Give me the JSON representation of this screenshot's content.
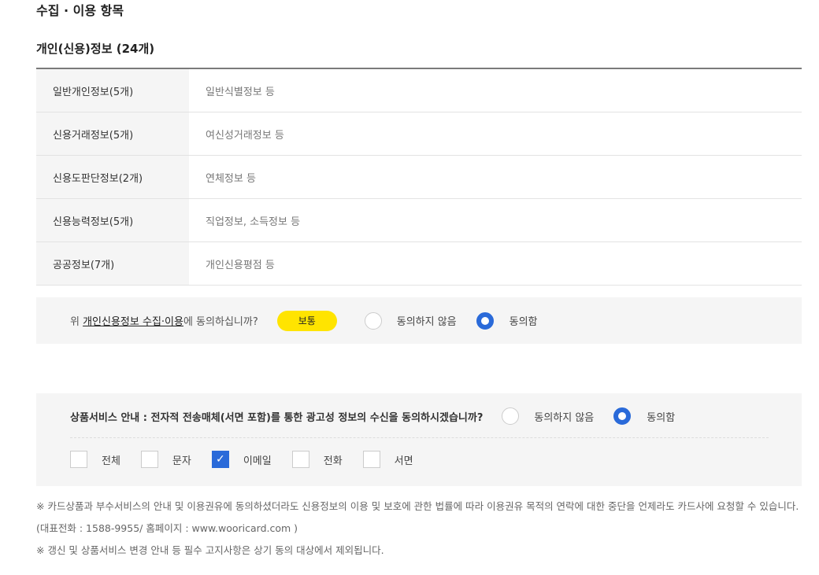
{
  "section_title": "수집 · 이용 항목",
  "sub_title": "개인(신용)정보 (24개)",
  "info_rows": [
    {
      "label": "일반개인정보(5개)",
      "value": "일반식별정보 등"
    },
    {
      "label": "신용거래정보(5개)",
      "value": "여신성거래정보 등"
    },
    {
      "label": "신용도판단정보(2개)",
      "value": "연체정보 등"
    },
    {
      "label": "신용능력정보(5개)",
      "value": "직업정보, 소득정보 등"
    },
    {
      "label": "공공정보(7개)",
      "value": "개인신용평점 등"
    }
  ],
  "consent": {
    "prefix": "위 ",
    "link": "개인신용정보 수집·이용",
    "suffix": "에 동의하십니까?",
    "badge": "보통",
    "disagree_label": "동의하지 않음",
    "agree_label": "동의함",
    "selected": "agree"
  },
  "marketing": {
    "question": "상품서비스 안내 : 전자적 전송매체(서면 포함)를 통한 광고성 정보의 수신을 동의하시겠습니까?",
    "disagree_label": "동의하지 않음",
    "agree_label": "동의함",
    "selected": "agree",
    "channels": [
      {
        "label": "전체",
        "checked": false
      },
      {
        "label": "문자",
        "checked": false
      },
      {
        "label": "이메일",
        "checked": true
      },
      {
        "label": "전화",
        "checked": false
      },
      {
        "label": "서면",
        "checked": false
      }
    ]
  },
  "notes": [
    "※ 카드상품과 부수서비스의 안내 및 이용권유에 동의하셨더라도 신용정보의 이용 및 보호에 관한 법률에 따라 이용권유 목적의 연락에 대한 중단을 언제라도 카드사에 요청할 수 있습니다. (대표전화 : 1588-9955/ 홈페이지 : www.wooricard.com )",
    "※ 갱신 및 상품서비스 변경 안내 등 필수 고지사항은 상기 동의 대상에서 제외됩니다."
  ],
  "colors": {
    "accent": "#2a6ad9",
    "badge": "#ffe400",
    "panel": "#f5f5f5"
  }
}
